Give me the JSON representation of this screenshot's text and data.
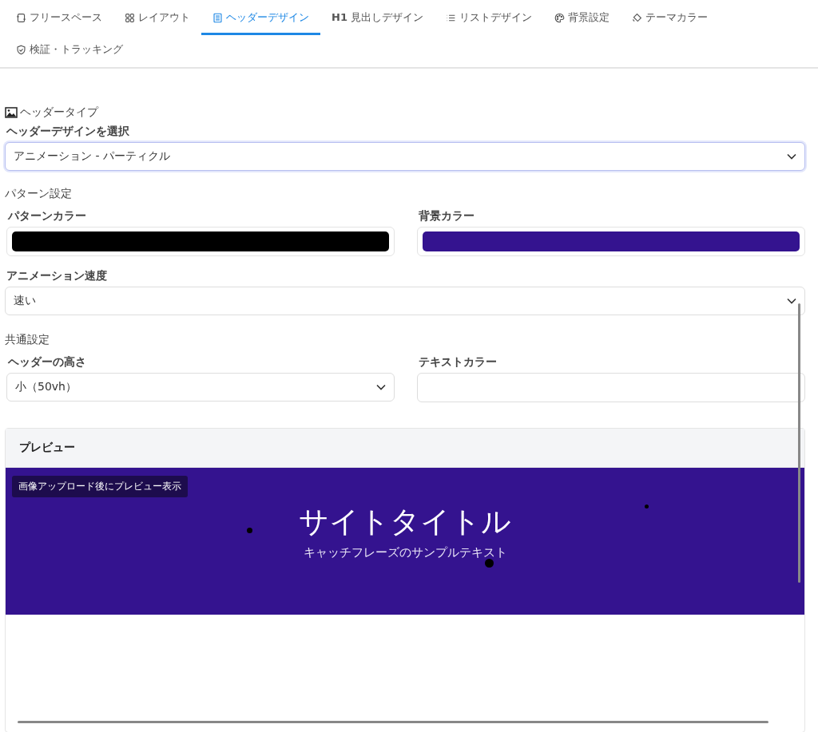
{
  "tabs": [
    {
      "label": "フリースペース",
      "selected": false
    },
    {
      "label": "レイアウト",
      "selected": false
    },
    {
      "label": "ヘッダーデザイン",
      "selected": true
    },
    {
      "label": "**H1** 見出しデザイン",
      "selected": false
    },
    {
      "label": "リストデザイン",
      "selected": false
    },
    {
      "label": "背景設定",
      "selected": false
    },
    {
      "label": "テーマカラー",
      "selected": false
    },
    {
      "label": "検証・トラッキング",
      "selected": false
    }
  ],
  "header_type": {
    "title": "ヘッダータイプ",
    "design_label": "ヘッダーデザインを選択",
    "design_value": "アニメーション - パーティクル"
  },
  "pattern_settings": {
    "title": "パターン設定",
    "color_fields": [
      {
        "label": "パターンカラー",
        "color": "#000000"
      },
      {
        "label": "背景カラー",
        "color": "#34138f"
      }
    ],
    "speed_label": "アニメーション速度",
    "speed_value": "速い"
  },
  "common_settings": {
    "title": "共通設定",
    "height_label": "ヘッダーの高さ",
    "height_value": "小（50vh）",
    "text_color_label": "テキストカラー"
  },
  "preview": {
    "title": "プレビュー",
    "notice": "画像アップロード後にプレビュー表示",
    "site_title": "サイトタイトル",
    "catchphrase": "キャッチフレーズのサンプルテキスト"
  }
}
